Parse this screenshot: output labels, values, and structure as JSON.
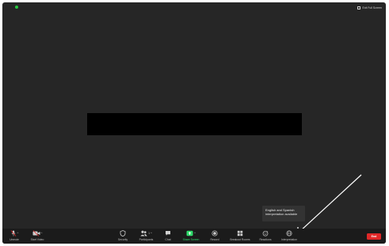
{
  "topbar": {
    "exit_fullscreen_label": "Exit Full Screen"
  },
  "tooltip": {
    "text": "English and Spanish interpretation available"
  },
  "toolbar": {
    "unmute_label": "Unmute",
    "start_video_label": "Start Video",
    "security_label": "Security",
    "participants_label": "Participants",
    "participants_count": "1",
    "chat_label": "Chat",
    "share_screen_label": "Share Screen",
    "record_label": "Record",
    "breakout_label": "Breakout Rooms",
    "reactions_label": "Reactions",
    "interpretation_label": "Interpretation",
    "end_label": "End"
  },
  "colors": {
    "meeting_bg": "#262626",
    "toolbar_bg": "#1b1b1b",
    "share_green": "#2fd96a",
    "end_red": "#e02828",
    "security_dot": "#27c93f"
  },
  "icons": {
    "unmute": "microphone-muted-icon",
    "start_video": "camera-off-icon",
    "security": "shield-icon",
    "participants": "people-icon",
    "chat": "chat-bubble-icon",
    "share_screen": "share-arrow-icon",
    "record": "record-dot-icon",
    "breakout": "grid-icon",
    "reactions": "emoji-icon",
    "interpretation": "globe-icon"
  }
}
